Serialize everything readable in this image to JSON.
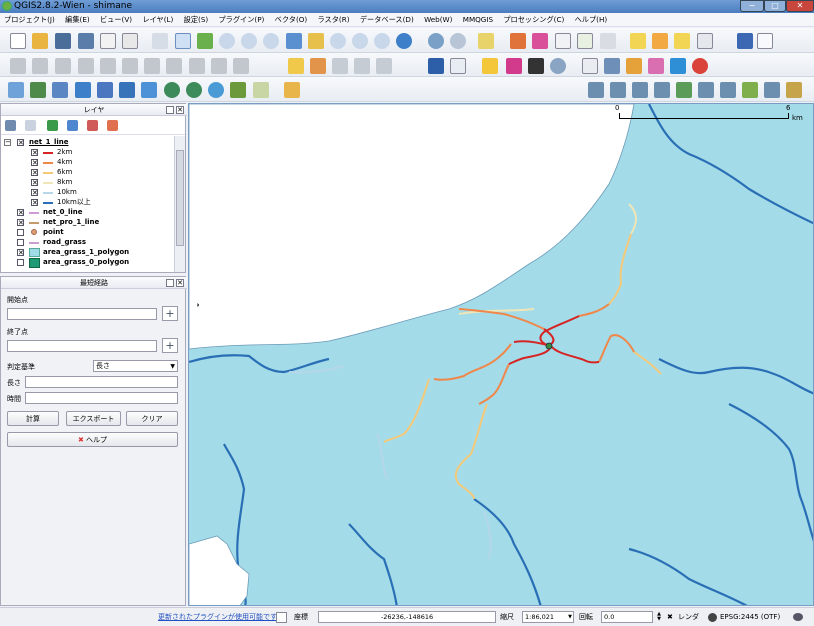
{
  "window": {
    "title": "QGIS2.8.2-Wien - shimane"
  },
  "menu": [
    "プロジェクト(J)",
    "編集(E)",
    "ビュー(V)",
    "レイヤ(L)",
    "設定(S)",
    "プラグイン(P)",
    "ベクタ(O)",
    "ラスタ(R)",
    "データベース(D)",
    "Web(W)",
    "MMQGIS",
    "プロセッシング(C)",
    "ヘルプ(H)"
  ],
  "layers_panel": {
    "title": "レイヤ",
    "items": [
      {
        "label": "net_1_line",
        "checked": true
      },
      {
        "label": "2km",
        "color": "#d62424",
        "checked": true
      },
      {
        "label": "4km",
        "color": "#f0874a",
        "checked": true
      },
      {
        "label": "6km",
        "color": "#f5c97a",
        "checked": true
      },
      {
        "label": "8km",
        "color": "#f3ecc4",
        "checked": true
      },
      {
        "label": "10km",
        "color": "#b5d7e8",
        "checked": true
      },
      {
        "label": "10km以上",
        "color": "#2a6fb5",
        "checked": true
      },
      {
        "label": "net_0_line",
        "color": "#d09ad4",
        "checked": true
      },
      {
        "label": "net_pro_1_line",
        "color": "#c79a6a",
        "checked": true
      },
      {
        "label": "point",
        "color": "#d8a070",
        "checked": false
      },
      {
        "label": "road_grass",
        "color": "#c8a0d0",
        "checked": false
      },
      {
        "label": "area_grass_1_polygon",
        "color": "#9fdbe8",
        "checked": true
      },
      {
        "label": "area_grass_0_polygon",
        "color": "#1e9a74",
        "checked": false
      }
    ]
  },
  "route_panel": {
    "title": "最短経路",
    "start_label": "開始点",
    "end_label": "終了点",
    "criterion_label": "判定基準",
    "criterion_value": "長さ",
    "length_label": "長さ",
    "time_label": "時間",
    "calc_button": "計算",
    "export_button": "エクスポート",
    "clear_button": "クリア",
    "help_button": "ヘルプ"
  },
  "map": {
    "scalebar_0": "0",
    "scalebar_6": "6",
    "scalebar_unit": "km",
    "sea_color": "#ffffff",
    "land_color": "#a3dbe8",
    "route_color": "#d62424"
  },
  "status": {
    "plugin_link": "更新されたプラグインが使用可能です",
    "coord_label": "座標",
    "coord_value": "-26236,-148616",
    "scale_label": "縮尺",
    "scale_value": "1:86,021",
    "rotation_label": "回転",
    "rotation_value": "0.0",
    "render_label": "レンダ",
    "crs": "EPSG:2445 (OTF)"
  }
}
